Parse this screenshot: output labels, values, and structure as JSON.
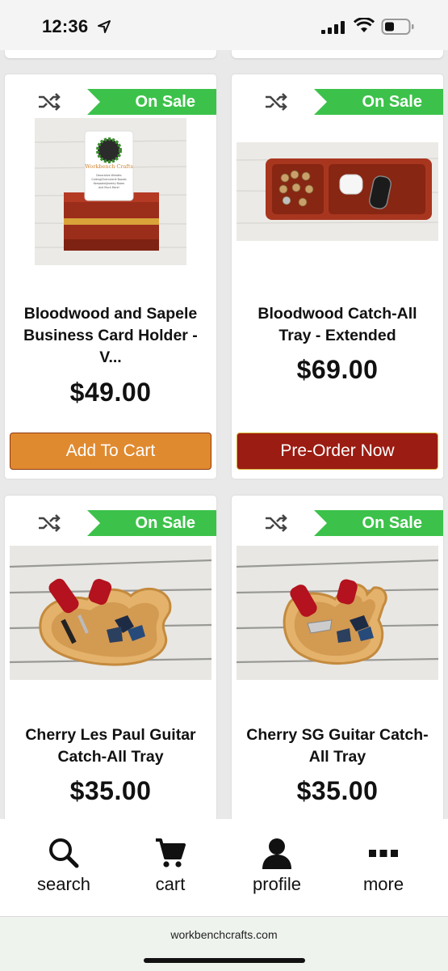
{
  "status_bar": {
    "time": "12:36"
  },
  "products": [
    {
      "badge": "On Sale",
      "name": "Bloodwood and Sapele Business Card Holder - V...",
      "price": "$49.00",
      "button": "Add To Cart",
      "image": "business-card-holder"
    },
    {
      "badge": "On Sale",
      "name": "Bloodwood Catch-All Tray - Extended",
      "price": "$69.00",
      "button": "Pre-Order Now",
      "image": "catch-all-tray"
    },
    {
      "badge": "On Sale",
      "name": "Cherry Les Paul Guitar Catch-All Tray",
      "price": "$35.00",
      "image": "les-paul-tray"
    },
    {
      "badge": "On Sale",
      "name": "Cherry SG Guitar Catch-All Tray",
      "price": "$35.00",
      "image": "sg-tray"
    }
  ],
  "business_card_text": [
    "Workbench Crafts",
    "Decorative Wreaths",
    "Cutting/Charcuterie Boards",
    "Keepsake/Jewelry Boxes",
    "And Much More!"
  ],
  "bottom_nav": [
    {
      "label": "search",
      "icon": "search-icon"
    },
    {
      "label": "cart",
      "icon": "cart-icon"
    },
    {
      "label": "profile",
      "icon": "profile-icon"
    },
    {
      "label": "more",
      "icon": "more-icon"
    }
  ],
  "url": "workbenchcrafts.com",
  "colors": {
    "sale_green": "#3cc24a",
    "add_to_cart": "#e08a30",
    "pre_order": "#9b1c12"
  }
}
